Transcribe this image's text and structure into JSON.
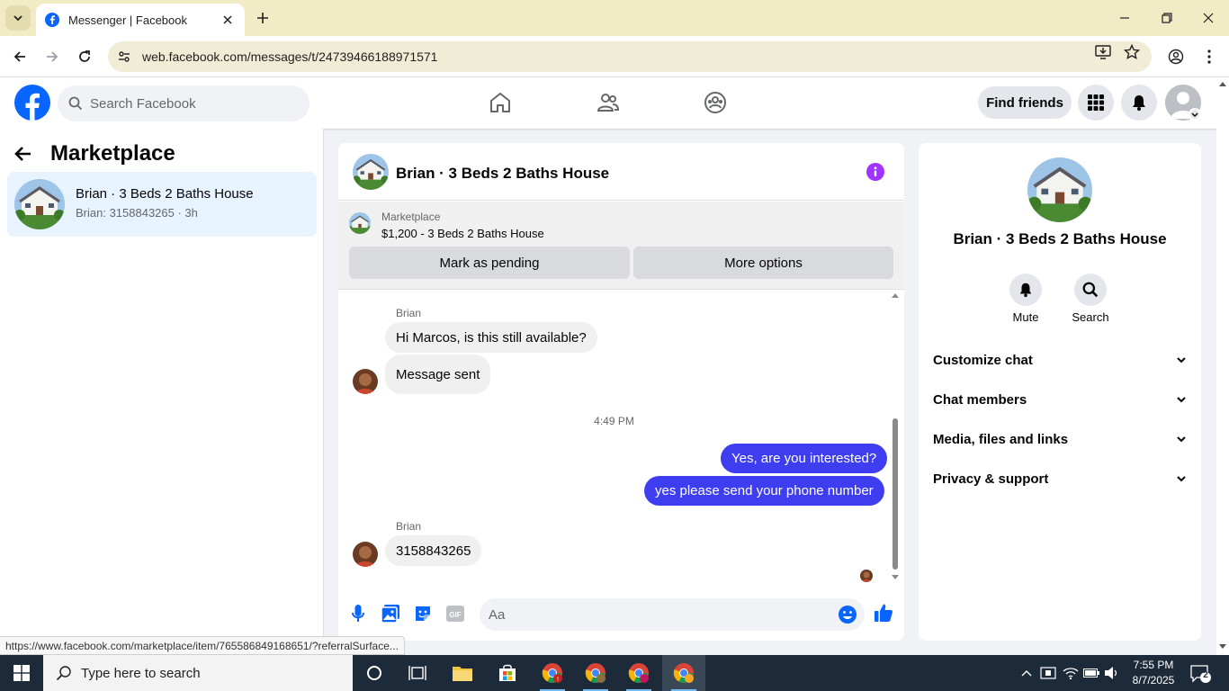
{
  "browser": {
    "tab_title": "Messenger | Facebook",
    "url": "web.facebook.com/messages/t/24739466188971571"
  },
  "header": {
    "search_placeholder": "Search Facebook",
    "find_friends_label": "Find friends"
  },
  "left_panel": {
    "title": "Marketplace",
    "conversations": [
      {
        "title": "Brian · 3 Beds 2 Baths House",
        "preview": "Brian: 3158843265 · 3h"
      }
    ]
  },
  "chat": {
    "title": "Brian · 3 Beds 2 Baths House",
    "listing": {
      "source": "Marketplace",
      "item": "$1,200 - 3 Beds 2 Baths House",
      "mark_pending_label": "Mark as pending",
      "more_options_label": "More options"
    },
    "messages": [
      {
        "sender": "Brian",
        "text": "Hi Marcos, is this still available?"
      },
      {
        "text": "Message sent"
      },
      {
        "timestamp": "4:49 PM"
      },
      {
        "text": "Yes, are you interested?"
      },
      {
        "text": "yes please send your phone number"
      },
      {
        "sender": "Brian",
        "text": "3158843265"
      }
    ],
    "composer_placeholder": "Aa"
  },
  "right_panel": {
    "title": "Brian · 3 Beds 2 Baths House",
    "actions": [
      {
        "label": "Mute"
      },
      {
        "label": "Search"
      }
    ],
    "sections": [
      {
        "label": "Customize chat"
      },
      {
        "label": "Chat members"
      },
      {
        "label": "Media, files and links"
      },
      {
        "label": "Privacy & support"
      }
    ]
  },
  "status_url": "https://www.facebook.com/marketplace/item/765586849168651/?referralSurface...",
  "taskbar": {
    "search_placeholder": "Type here to search",
    "time": "7:55 PM",
    "date": "8/7/2025",
    "notification_count": "2"
  },
  "colors": {
    "facebook_blue": "#0866ff",
    "outgoing_bubble": "#3e3ef0",
    "selected_conversation": "#e7f3ff",
    "info_purple": "#a033ff"
  }
}
